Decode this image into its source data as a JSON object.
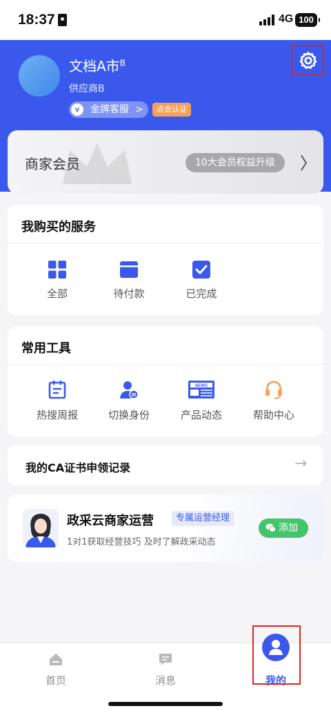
{
  "status_bar": {
    "time": "18:37",
    "network": "4G",
    "battery": "100"
  },
  "profile": {
    "name": "文档A市",
    "name_sup": "B",
    "role": "供应商B",
    "service_label": "金牌客服",
    "service_chevron": ">",
    "service_icon_glyph": "v",
    "verify_tag": "点击认证"
  },
  "member": {
    "title": "商家会员",
    "benefit_label": "10大会员权益升级",
    "chevron": "〉"
  },
  "purchased_services": {
    "title": "我购买的服务",
    "items": [
      {
        "label": "全部",
        "icon": "grid-icon"
      },
      {
        "label": "待付款",
        "icon": "wallet-icon"
      },
      {
        "label": "已完成",
        "icon": "check-icon"
      }
    ]
  },
  "tools": {
    "title": "常用工具",
    "items": [
      {
        "label": "热搜周报",
        "icon": "calendar-icon"
      },
      {
        "label": "切换身份",
        "icon": "switch-user-icon"
      },
      {
        "label": "产品动态",
        "icon": "news-icon"
      },
      {
        "label": "帮助中心",
        "icon": "headset-icon"
      }
    ]
  },
  "ca_record": {
    "label": "我的CA证书申领记录",
    "arrow": "→"
  },
  "operations": {
    "title": "政采云商家运营",
    "tag": "专属运营经理",
    "subtitle": "1对1获取经营技巧 及时了解政采动态",
    "add_label": "添加"
  },
  "tab_bar": {
    "tabs": [
      {
        "label": "首页",
        "icon": "home-icon"
      },
      {
        "label": "消息",
        "icon": "message-icon"
      },
      {
        "label": "我的",
        "icon": "user-icon"
      }
    ]
  },
  "colors": {
    "brand": "#3a59ec",
    "accent_orange": "#f6a15a",
    "wechat_green": "#44c46b",
    "highlight_red": "#e2231a"
  }
}
